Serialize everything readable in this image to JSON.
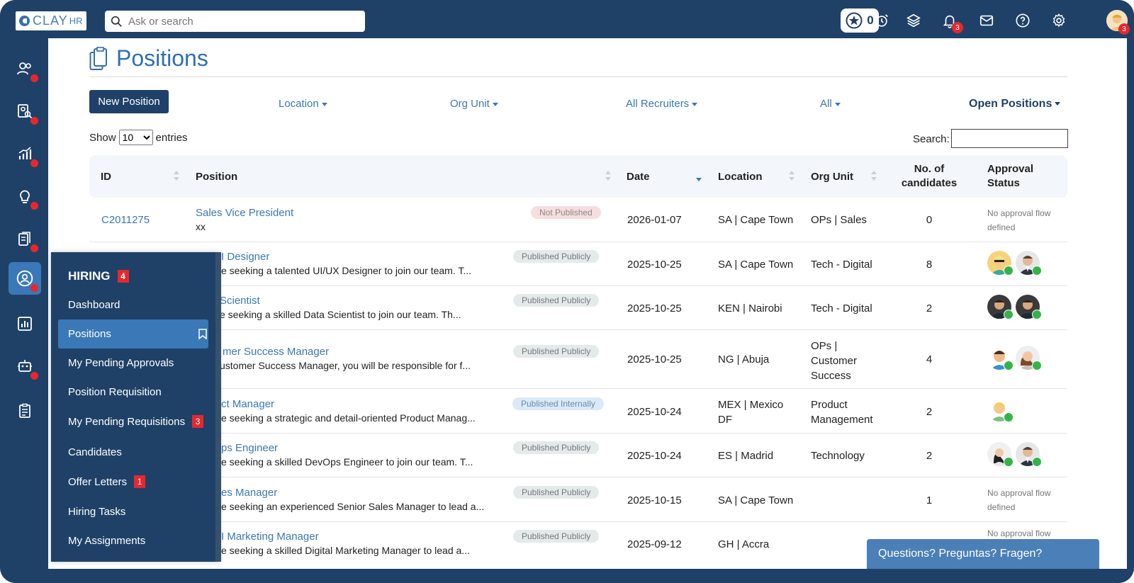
{
  "brand": {
    "name": "CLAY",
    "suffix": "HR"
  },
  "topbar": {
    "search_placeholder": "Ask or search",
    "star_count": "0",
    "notification_count": "3",
    "user_badge": "3",
    "icons": [
      "star-icon",
      "alarm-clock-icon",
      "layers-icon",
      "bell-icon",
      "mail-icon",
      "help-icon",
      "gear-icon",
      "user-avatar"
    ]
  },
  "sidebar": {
    "icons": [
      "people-icon",
      "person-search-icon",
      "chart-icon",
      "lightbulb-icon",
      "documents-icon",
      "hiring-icon",
      "report-icon",
      "robot-icon",
      "clipboard-icon"
    ]
  },
  "page": {
    "title": "Positions",
    "new_button": "New Position",
    "filters": {
      "location": "Location",
      "org_unit": "Org Unit",
      "recruiters": "All Recruiters",
      "all": "All",
      "open": "Open Positions"
    },
    "show_label": "Show",
    "entries_label": "entries",
    "entries_value": "10",
    "search_label": "Search:"
  },
  "table": {
    "headers": {
      "id": "ID",
      "position": "Position",
      "date": "Date",
      "location": "Location",
      "org_unit": "Org Unit",
      "candidates_1": "No. of",
      "candidates_2": "candidates",
      "approval_1": "Approval",
      "approval_2": "Status"
    },
    "rows": [
      {
        "id": "C2011275",
        "title": "Sales Vice President",
        "desc": "xx",
        "status": "Not Published",
        "date": "2026-01-07",
        "location": "SA | Cape Town",
        "org_unit": "OPs | Sales",
        "candidates": "0",
        "approval": "No approval flow defined"
      },
      {
        "id": "",
        "title": "I Designer",
        "desc": "e seeking a talented UI/UX Designer to join our team. T...",
        "status": "Published Publicly",
        "date": "2025-10-25",
        "location": "SA | Cape Town",
        "org_unit": "Tech - Digital",
        "candidates": "8",
        "approval": ""
      },
      {
        "id": "",
        "title": "Scientist",
        "desc": "e seeking a skilled Data Scientist to join our team. Th...",
        "status": "Published Publicly",
        "date": "2025-10-25",
        "location": "KEN | Nairobi",
        "org_unit": "Tech - Digital",
        "candidates": "2",
        "approval": ""
      },
      {
        "id": "",
        "title": "mer Success Manager",
        "desc": "ustomer Success Manager, you will be responsible for f...",
        "status": "Published Publicly",
        "date": "2025-10-25",
        "location": "NG | Abuja",
        "org_unit": "OPs | Customer Success",
        "candidates": "4",
        "approval": ""
      },
      {
        "id": "",
        "title": "ct Manager",
        "desc": "e seeking a strategic and detail-oriented Product Manag...",
        "status": "Published Internally",
        "date": "2025-10-24",
        "location": "MEX | Mexico DF",
        "org_unit": "Product Management",
        "candidates": "2",
        "approval": ""
      },
      {
        "id": "",
        "title": "ps Engineer",
        "desc": "e seeking a skilled DevOps Engineer to join our team. T...",
        "status": "Published Publicly",
        "date": "2025-10-24",
        "location": "ES | Madrid",
        "org_unit": "Technology",
        "candidates": "2",
        "approval": ""
      },
      {
        "id": "",
        "title": "es Manager",
        "desc": "e seeking an experienced Senior Sales Manager to lead a...",
        "status": "Published Publicly",
        "date": "2025-10-15",
        "location": "SA | Cape Town",
        "org_unit": "",
        "candidates": "1",
        "approval": "No approval flow defined"
      },
      {
        "id": "",
        "title": "I Marketing Manager",
        "desc": "e seeking a skilled Digital Marketing Manager to lead a...",
        "status": "Published Publicly",
        "date": "2025-09-12",
        "location": "GH | Accra",
        "org_unit": "",
        "candidates": "",
        "approval": "No approval flow"
      }
    ]
  },
  "menu": {
    "title": "HIRING",
    "title_badge": "4",
    "items": [
      {
        "label": "Dashboard"
      },
      {
        "label": "Positions"
      },
      {
        "label": "My Pending Approvals"
      },
      {
        "label": "Position Requisition"
      },
      {
        "label": "My Pending Requisitions",
        "badge": "3"
      },
      {
        "label": "Candidates"
      },
      {
        "label": "Offer Letters",
        "badge": "1"
      },
      {
        "label": "Hiring Tasks"
      },
      {
        "label": "My Assignments"
      }
    ]
  },
  "help": {
    "label": "Questions? Preguntas? Fragen?"
  },
  "colors": {
    "navy": "#1f4168",
    "accent": "#3a78b8",
    "badge": "#e6282e",
    "approved": "#34b34a"
  }
}
